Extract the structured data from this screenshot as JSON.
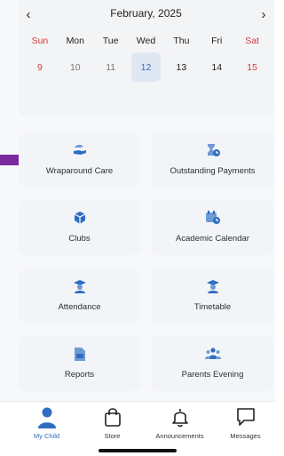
{
  "calendar": {
    "month_label": "February, 2025",
    "prev_icon": "chevron-left-icon",
    "next_icon": "chevron-right-icon",
    "prev_glyph": "‹",
    "next_glyph": "›",
    "weekdays": [
      "Sun",
      "Mon",
      "Tue",
      "Wed",
      "Thu",
      "Fri",
      "Sat"
    ],
    "dates": [
      "9",
      "10",
      "11",
      "12",
      "13",
      "14",
      "15"
    ],
    "selected_date": "12"
  },
  "tiles": [
    {
      "label": "Wraparound Care",
      "icon": "hand-heart-icon"
    },
    {
      "label": "Outstanding Payments",
      "icon": "hourglass-icon"
    },
    {
      "label": "Clubs",
      "icon": "cube-icon"
    },
    {
      "label": "Academic Calendar",
      "icon": "calendar-clock-icon"
    },
    {
      "label": "Attendance",
      "icon": "graduation-cap-icon"
    },
    {
      "label": "Timetable",
      "icon": "graduation-cap-icon"
    },
    {
      "label": "Reports",
      "icon": "document-icon"
    },
    {
      "label": "Parents Evening",
      "icon": "group-icon"
    }
  ],
  "bottom_nav": [
    {
      "label": "My Child",
      "icon": "person-icon",
      "active": true
    },
    {
      "label": "Store",
      "icon": "shopping-bag-icon",
      "active": false
    },
    {
      "label": "Announcements",
      "icon": "bell-icon",
      "active": false
    },
    {
      "label": "Messages",
      "icon": "chat-bubble-icon",
      "active": false
    }
  ],
  "colors": {
    "accent": "#2f6dc0",
    "weekend": "#d23b3b",
    "pointer_arrow": "#7a2aa0",
    "tile_background": "#f2f4f7"
  }
}
